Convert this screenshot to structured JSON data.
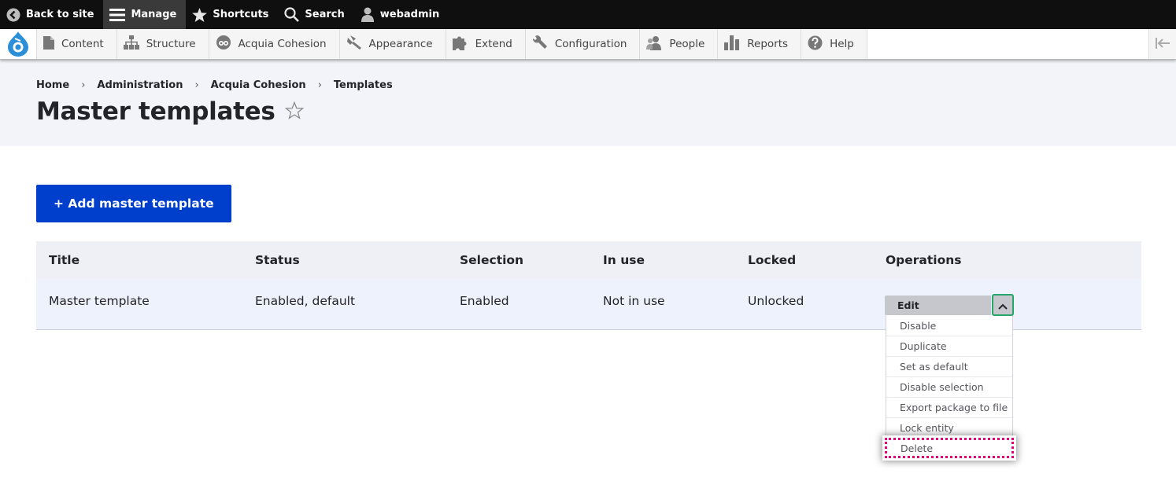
{
  "toolbar": {
    "back_label": "Back to site",
    "manage_label": "Manage",
    "shortcuts_label": "Shortcuts",
    "search_label": "Search",
    "user_label": "webadmin"
  },
  "tray": {
    "items": [
      {
        "label": "Content",
        "icon": "content-icon"
      },
      {
        "label": "Structure",
        "icon": "structure-icon"
      },
      {
        "label": "Acquia Cohesion",
        "icon": "cohesion-icon"
      },
      {
        "label": "Appearance",
        "icon": "appearance-icon"
      },
      {
        "label": "Extend",
        "icon": "extend-icon"
      },
      {
        "label": "Configuration",
        "icon": "wrench-icon"
      },
      {
        "label": "People",
        "icon": "people-icon"
      },
      {
        "label": "Reports",
        "icon": "reports-icon"
      },
      {
        "label": "Help",
        "icon": "help-icon"
      }
    ]
  },
  "breadcrumb": [
    "Home",
    "Administration",
    "Acquia Cohesion",
    "Templates"
  ],
  "page": {
    "title": "Master templates",
    "add_button": "+ Add master template"
  },
  "table": {
    "headers": [
      "Title",
      "Status",
      "Selection",
      "In use",
      "Locked",
      "Operations"
    ],
    "rows": [
      {
        "title": "Master template",
        "status": "Enabled, default",
        "selection": "Enabled",
        "in_use": "Not in use",
        "locked": "Unlocked"
      }
    ]
  },
  "operations": {
    "primary": "Edit",
    "items": [
      "Disable",
      "Duplicate",
      "Set as default",
      "Disable selection",
      "Export package to file",
      "Lock entity",
      "Delete"
    ]
  },
  "colors": {
    "primary_button": "#003ecc",
    "focus_outline": "#26a769",
    "focus_dotted": "#e2007a"
  }
}
